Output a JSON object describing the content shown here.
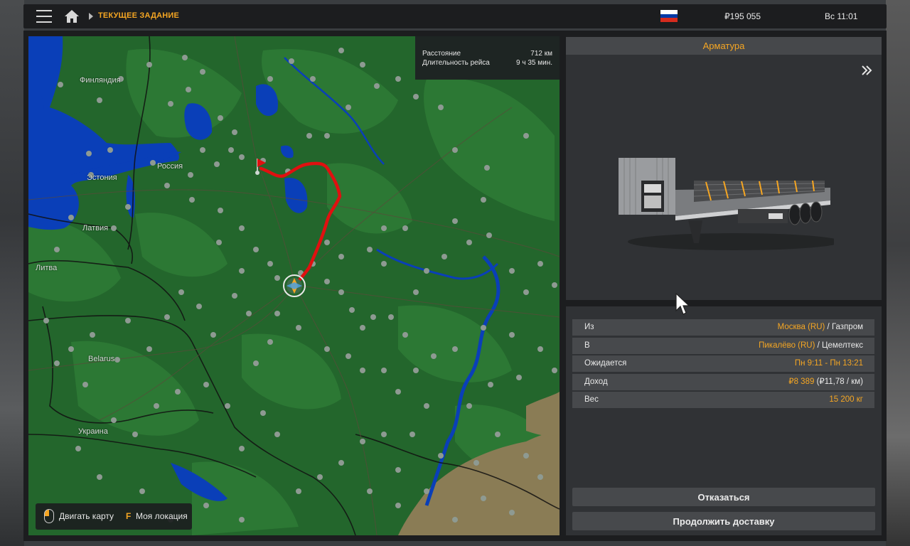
{
  "topbar": {
    "breadcrumb": "ТЕКУЩЕЕ ЗАДАНИЕ",
    "money": "₽195 055",
    "time": "Вс 11:01",
    "flag_colors": [
      "#ffffff",
      "#0039a6",
      "#d52b1e"
    ]
  },
  "map": {
    "info": {
      "distance_label": "Расстояние",
      "distance_value": "712 км",
      "duration_label": "Длительность рейса",
      "duration_value": "9 ч 35 мин."
    },
    "labels": {
      "finland": "Финляндия",
      "estonia": "Эстония",
      "russia": "Россия",
      "latvia": "Латвия",
      "lithuania": "Литва",
      "belarus": "Belarus",
      "ukraine": "Украина"
    },
    "controls": {
      "move_map": "Двигать карту",
      "key": "F",
      "my_location": "Моя локация"
    },
    "colors": {
      "land": "#23662c",
      "water": "#0a3fb8",
      "route": "#e01010",
      "city": "#8e9a92"
    }
  },
  "cargo": {
    "name": "Арматура"
  },
  "details": {
    "from_label": "Из",
    "from_city": "Москва (RU)",
    "from_company": " / Газпром",
    "to_label": "В",
    "to_city": "Пикалёво (RU)",
    "to_company": " / Цемелтекс",
    "expected_label": "Ожидается",
    "expected_value": "Пн 9:11 - Пн 13:21",
    "income_label": "Доход",
    "income_value": "₽8 389",
    "income_rate": " (₽11,78 / км)",
    "weight_label": "Вес",
    "weight_value": "15 200 кг"
  },
  "actions": {
    "decline": "Отказаться",
    "continue": "Продолжить доставку"
  },
  "accent_color": "#f5a623"
}
